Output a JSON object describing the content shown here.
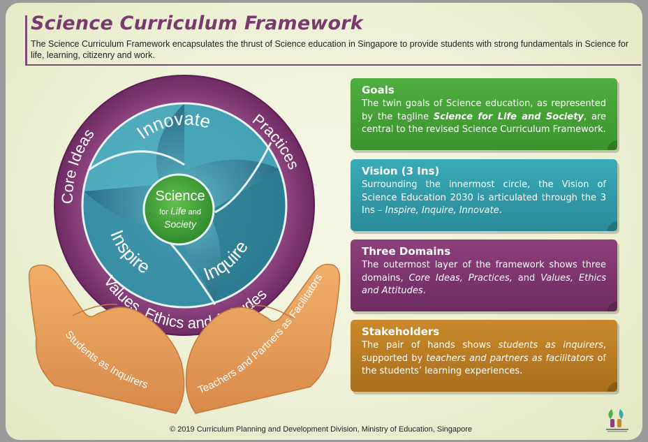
{
  "header": {
    "title": "Science Curriculum Framework",
    "subtitle": "The Science Curriculum Framework encapsulates the thrust of Science education in Singapore to provide students with strong fundamentals in Science for life, learning, citizenry and work."
  },
  "diagram": {
    "center": {
      "line1": "Science",
      "line2a": "for ",
      "line2b": "Life",
      "line2c": " and",
      "line3": "Society"
    },
    "vision": [
      "Innovate",
      "Inquire",
      "Inspire"
    ],
    "domains": [
      "Core Ideas",
      "Practices",
      "Values, Ethics and Attitudes"
    ],
    "hands": {
      "left": "Students as Inquirers",
      "right": "Teachers and Partners as Facilitators"
    }
  },
  "panels": {
    "goals": {
      "title": "Goals",
      "text_a": "The twin goals of Science education, as represented by the tagline ",
      "text_b": "Science for Life and Society",
      "text_c": ", are central to the revised Science Curriculum Framework."
    },
    "vision": {
      "title": "Vision (3 Ins)",
      "text_a": "Surrounding the innermost circle, the Vision of Science Education 2030 is articulated through the 3 Ins – ",
      "text_b": "Inspire, Inquire, Innovate",
      "text_c": "."
    },
    "domains": {
      "title": "Three Domains",
      "text_a": "The outermost layer of the framework shows three domains, ",
      "text_b": "Core Ideas, Practices,",
      "text_c": " and ",
      "text_d": "Values, Ethics and Attitudes",
      "text_e": "."
    },
    "stakeholders": {
      "title": "Stakeholders",
      "text_a": "The pair of hands shows ",
      "text_b": "students as inquirers",
      "text_c": ", supported by ",
      "text_d": "teachers and partners as facilitators",
      "text_e": " of the students’ learning experiences."
    }
  },
  "footer": {
    "text": "© 2019 Curriculum Planning and Development Division, Ministry of Education, Singapore"
  },
  "colors": {
    "purple": "#7a3a70",
    "green": "#4fae3f",
    "teal": "#3aaab7",
    "orange": "#c98a2c"
  }
}
